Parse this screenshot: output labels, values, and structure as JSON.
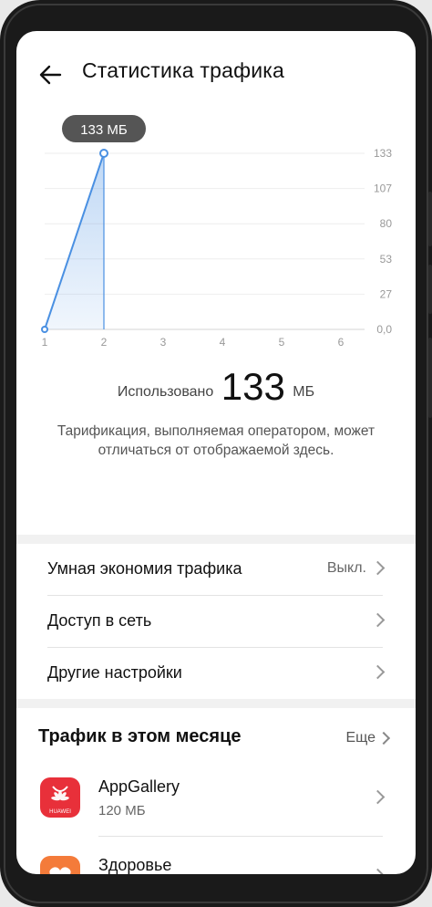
{
  "header": {
    "title": "Статистика трафика"
  },
  "chart_data": {
    "type": "area",
    "x": [
      1,
      2
    ],
    "values": [
      0,
      133
    ],
    "x_ticks": [
      "1",
      "2",
      "3",
      "4",
      "5",
      "6"
    ],
    "y_ticks": [
      "133",
      "107",
      "80",
      "53",
      "27",
      "0,0"
    ],
    "ylim": [
      0,
      133
    ],
    "tooltip": "133 МБ",
    "color": "#4a90e2"
  },
  "usage": {
    "label": "Использовано",
    "value": "133",
    "unit": "МБ"
  },
  "note": "Тарификация, выполняемая оператором, может отличаться от отображаемой здесь.",
  "settings": {
    "smart_saver": {
      "label": "Умная экономия трафика",
      "value": "Выкл."
    },
    "network_access": {
      "label": "Доступ в сеть"
    },
    "other": {
      "label": "Другие настройки"
    }
  },
  "month": {
    "title": "Трафик в этом месяце",
    "more": "Еще",
    "apps": [
      {
        "name": "AppGallery",
        "size": "120 МБ",
        "icon_text": "HUAWEI",
        "color": "#e8303a"
      },
      {
        "name": "Здоровье",
        "size": "",
        "color": "#f47b3a"
      }
    ]
  }
}
